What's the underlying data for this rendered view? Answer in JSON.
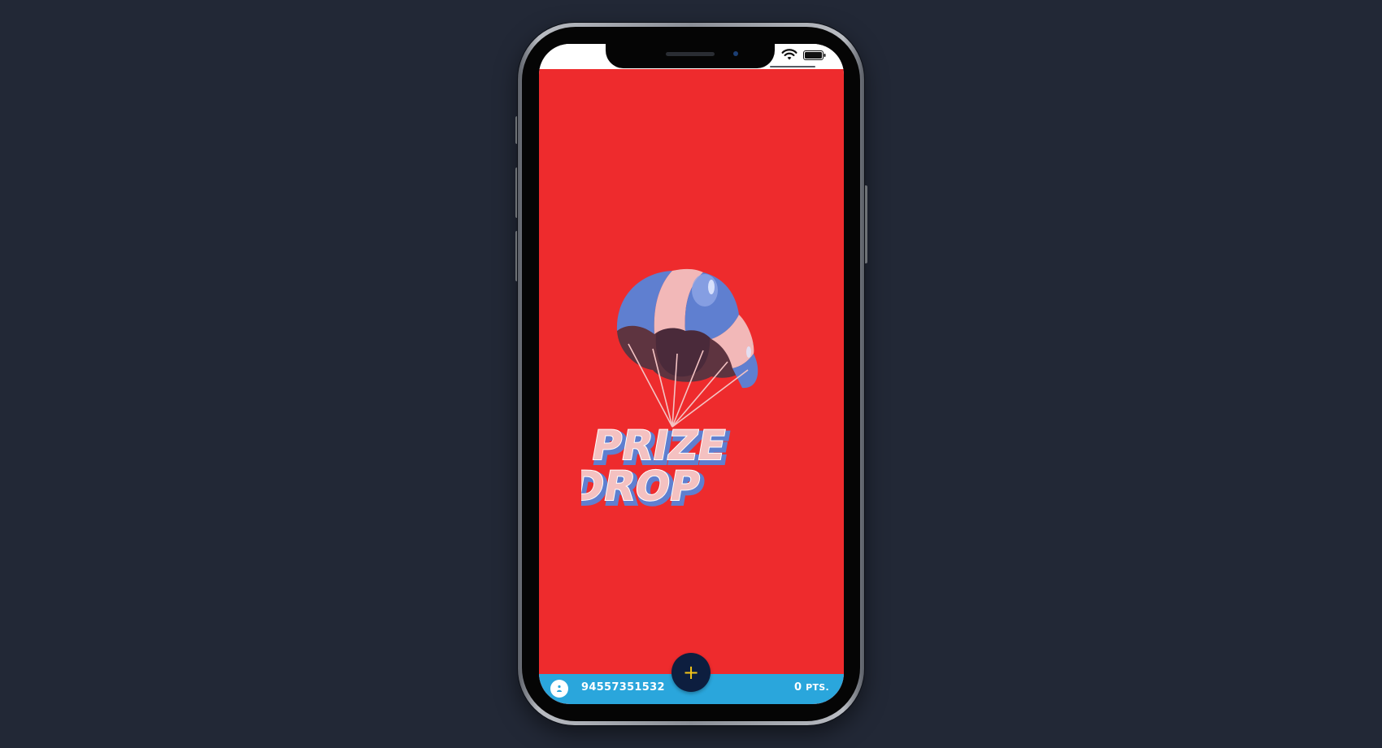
{
  "app": {
    "name": "Prize Drop",
    "logo_line1": "PRIZE",
    "logo_line2": "DROP"
  },
  "status_bar": {
    "icons": [
      "wifi-icon",
      "battery-icon"
    ]
  },
  "bottom_bar": {
    "user_id": "94557351532",
    "points_value": "0",
    "points_unit": "PTS.",
    "add_button_label": "+"
  },
  "colors": {
    "page_background": "#222836",
    "app_background": "#ee2b2d",
    "bottom_bar": "#2aa6dc",
    "add_button": "#0d1e3f",
    "add_button_icon": "#f5c518",
    "parachute_blue": "#5f7fd0",
    "parachute_pink": "#f2b8b8"
  }
}
